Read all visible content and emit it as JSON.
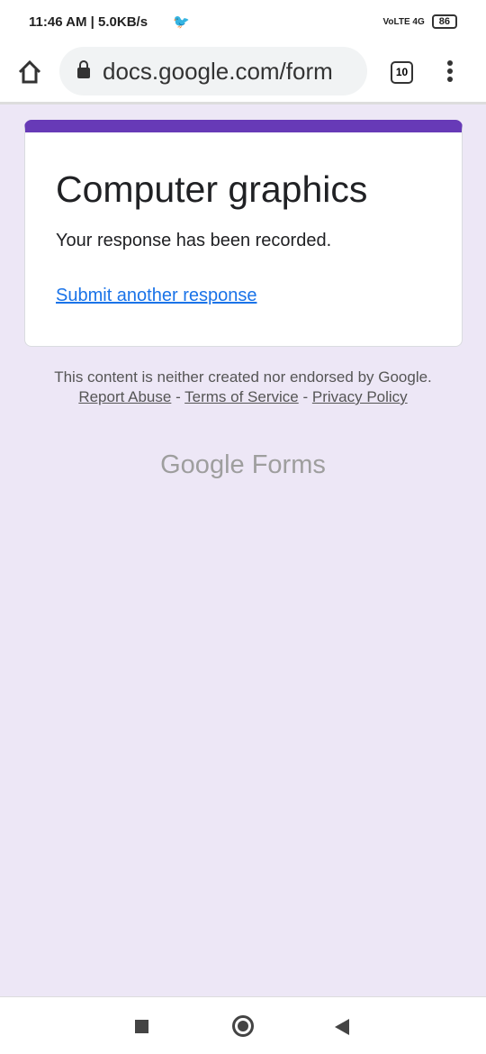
{
  "status": {
    "time": "11:46 AM | 5.0KB/s",
    "network": "VoLTE 4G",
    "battery": "86"
  },
  "browser": {
    "url": "docs.google.com/form",
    "tab_count": "10"
  },
  "form": {
    "title": "Computer graphics",
    "message": "Your response has been recorded.",
    "submit_another": "Submit another response"
  },
  "footer": {
    "text": "This content is neither created nor endorsed by Google.",
    "report_abuse": "Report Abuse",
    "sep": " - ",
    "terms": "Terms of Service",
    "privacy": "Privacy Policy"
  },
  "logo": {
    "google": "Google",
    "forms": "Forms"
  }
}
